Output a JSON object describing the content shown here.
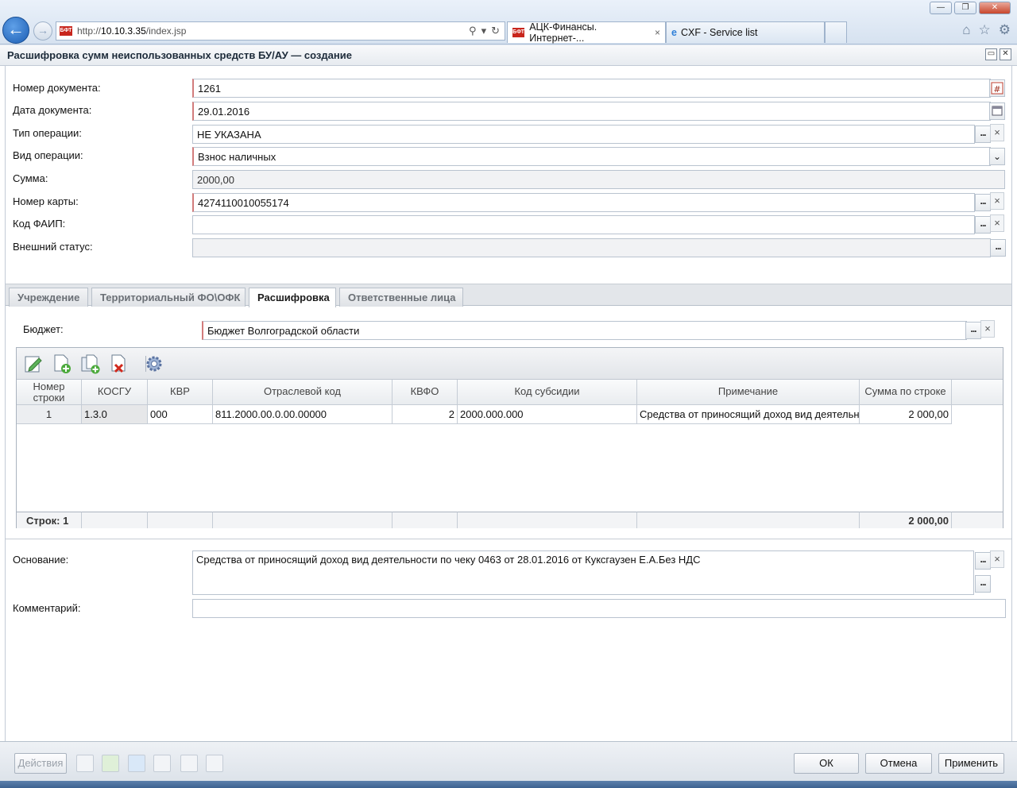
{
  "browser": {
    "url_prefix": "http://",
    "url_host": "10.10.3.35",
    "url_path": "/index.jsp",
    "favicon_text": "БФТ",
    "tabs": [
      {
        "label": "АЦК-Финансы. Интернет-...",
        "close": "×"
      },
      {
        "label": "CXF - Service list"
      }
    ]
  },
  "window": {
    "title": "Расшифровка сумм неиспользованных средств БУ/АУ — создание"
  },
  "form": {
    "doc_number": {
      "label": "Номер документа:",
      "value": "1261"
    },
    "doc_date": {
      "label": "Дата документа:",
      "value": "29.01.2016"
    },
    "op_type": {
      "label": "Тип операции:",
      "value": "НЕ УКАЗАНА"
    },
    "op_kind": {
      "label": "Вид операции:",
      "value": "Взнос наличных"
    },
    "amount": {
      "label": "Сумма:",
      "value": "2000,00"
    },
    "card_number": {
      "label": "Номер карты:",
      "value": "4274110010055174"
    },
    "faip_code": {
      "label": "Код ФАИП:",
      "value": ""
    },
    "ext_status": {
      "label": "Внешний статус:",
      "value": ""
    }
  },
  "tabs": [
    {
      "label": "Учреждение"
    },
    {
      "label": "Территориальный ФО\\ОФК"
    },
    {
      "label": "Расшифровка"
    },
    {
      "label": "Ответственные лица"
    }
  ],
  "budget": {
    "label": "Бюджет:",
    "value": "Бюджет Волгоградской области"
  },
  "grid": {
    "columns": [
      "Номер строки",
      "КОСГУ",
      "КВР",
      "Отраслевой код",
      "КВФО",
      "Код субсидии",
      "Примечание",
      "Сумма по строке"
    ],
    "col_row_top": "Номер",
    "col_row_bottom": "строки",
    "rows": [
      {
        "n": "1",
        "kosgu": "1.3.0",
        "kvr": "000",
        "branch_code": "811.2000.00.0.00.00000",
        "kvfo": "2",
        "subsidy": "2000.000.000",
        "note": "Средства от приносящий доход вид деятельности",
        "sum": "2 000,00"
      }
    ],
    "footer_label": "Строк: 1",
    "footer_total": "2 000,00"
  },
  "basis": {
    "label": "Основание:",
    "value": "Средства от приносящий доход вид деятельности по чеку 0463 от 28.01.2016 от Кукcгаузен Е.А.Без НДС"
  },
  "comment": {
    "label": "Комментарий:",
    "value": ""
  },
  "footer": {
    "actions_label": "Действия",
    "ok_label": "ОК",
    "cancel_label": "Отмена",
    "apply_label": "Применить"
  },
  "buttons": {
    "dots": "...",
    "clear": "×"
  }
}
